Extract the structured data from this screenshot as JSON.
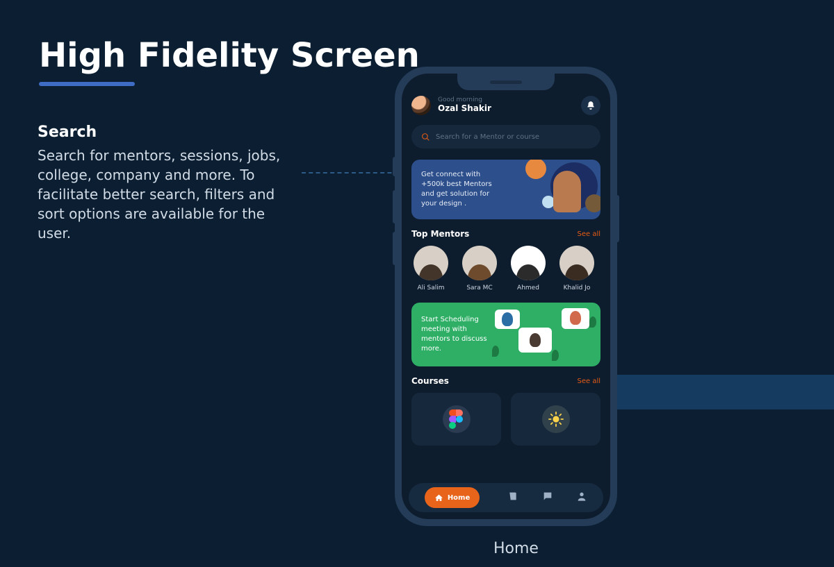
{
  "page": {
    "title": "High Fidelity Screen",
    "section_title": "Search",
    "section_desc": "Search for mentors, sessions, jobs, college, company and more. To facilitate better search, filters and sort options are available for the user.",
    "phone_label": "Home"
  },
  "header": {
    "greeting": "Good morning",
    "username": "Ozal Shakir"
  },
  "search": {
    "placeholder": "Search for a Mentor or course"
  },
  "banner_connect": "Get connect with +500k best Mentors and get solution for your design .",
  "banner_schedule": "Start Scheduling meeting with mentors to discuss more.",
  "sections": {
    "mentors_title": "Top Mentors",
    "mentors_see": "See all",
    "courses_title": "Courses",
    "courses_see": "See all"
  },
  "mentors": [
    {
      "name": "Ali Salim"
    },
    {
      "name": "Sara MC"
    },
    {
      "name": "Ahmed"
    },
    {
      "name": "Khalid Jo"
    }
  ],
  "tabbar": {
    "home": "Home"
  }
}
